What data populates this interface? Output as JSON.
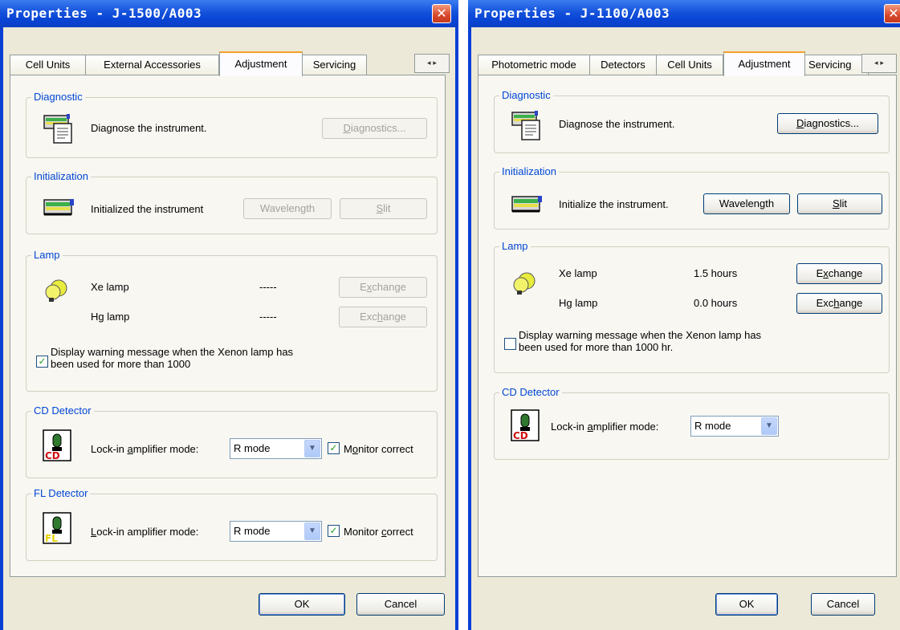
{
  "left": {
    "title": "Properties - J-1500/A003",
    "close": "✕",
    "tabs": [
      "Cell Units",
      "External Accessories",
      "Adjustment",
      "Servicing"
    ],
    "tab_scroll": "◂ ▸",
    "diagnostic": {
      "title": "Diagnostic",
      "text": "Diagnose the instrument.",
      "btn": "Diagnostics..."
    },
    "initialization": {
      "title": "Initialization",
      "text": "Initialized the instrument",
      "wavelength": "Wavelength",
      "slit": "Slit"
    },
    "lamp": {
      "title": "Lamp",
      "xe_label": "Xe lamp",
      "xe_value": "-----",
      "xe_btn": "Exchange",
      "hg_label": "Hg lamp",
      "hg_value": "-----",
      "hg_btn": "Exchange",
      "warn_checked": true,
      "warn_line1": "Display warning message when the Xenon lamp has",
      "warn_line2": "been used for more than 1000"
    },
    "cd": {
      "title": "CD Detector",
      "label": "Lock-in amplifier mode:",
      "mode": "R mode",
      "monitor_checked": true,
      "monitor": "Monitor correct"
    },
    "fl": {
      "title": "FL Detector",
      "label": "Lock-in amplifier mode:",
      "mode": "R mode",
      "monitor_checked": true,
      "monitor": "Monitor correct"
    },
    "ok": "OK",
    "cancel": "Cancel"
  },
  "right": {
    "title": "Properties - J-1100/A003",
    "close": "✕",
    "tabs": [
      "Photometric mode",
      "Detectors",
      "Cell Units",
      "Adjustment",
      "Servicing"
    ],
    "tab_scroll": "◂ ▸",
    "diagnostic": {
      "title": "Diagnostic",
      "text": "Diagnose the instrument.",
      "btn": "Diagnostics..."
    },
    "initialization": {
      "title": "Initialization",
      "text": "Initialize the instrument.",
      "wavelength": "Wavelength",
      "slit": "Slit"
    },
    "lamp": {
      "title": "Lamp",
      "xe_label": "Xe lamp",
      "xe_value": "1.5 hours",
      "xe_btn": "Exchange",
      "hg_label": "Hg lamp",
      "hg_value": "0.0 hours",
      "hg_btn": "Exchange",
      "warn_checked": false,
      "warn_line1": "Display warning message when the Xenon lamp has",
      "warn_line2": "been used for more than 1000 hr."
    },
    "cd": {
      "title": "CD Detector",
      "label": "Lock-in amplifier mode:",
      "mode": "R mode"
    },
    "ok": "OK",
    "cancel": "Cancel"
  },
  "colors": {
    "title_blue": "#0a45d6",
    "group_title": "#0046d5",
    "dialog_face": "#ece9d8",
    "active_tab": "#f5a02a"
  }
}
